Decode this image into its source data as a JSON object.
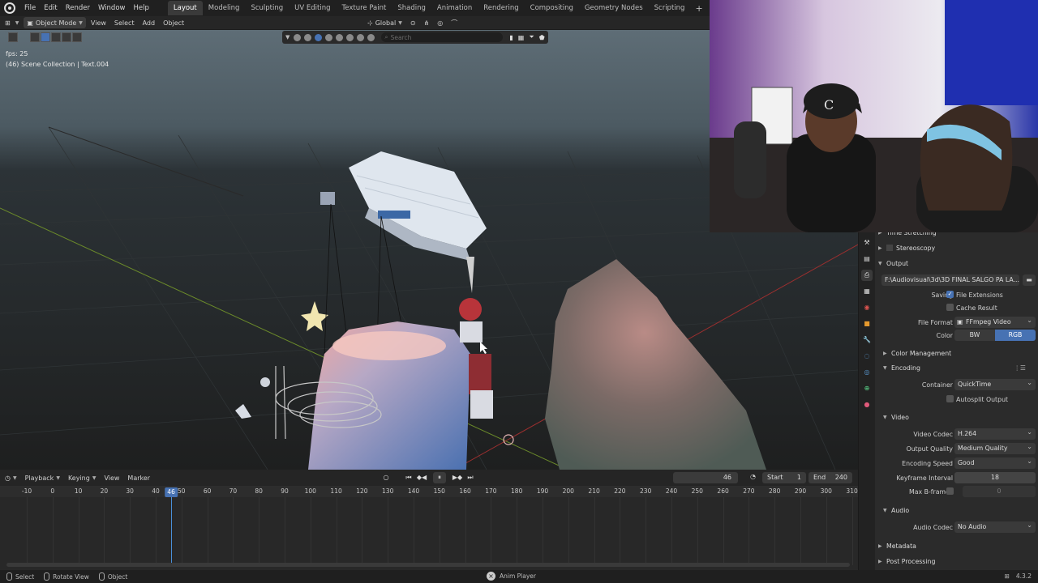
{
  "topbar": {
    "menus": [
      "File",
      "Edit",
      "Render",
      "Window",
      "Help"
    ],
    "workspaces": [
      "Layout",
      "Modeling",
      "Sculpting",
      "UV Editing",
      "Texture Paint",
      "Shading",
      "Animation",
      "Rendering",
      "Compositing",
      "Geometry Nodes",
      "Scripting"
    ],
    "active_workspace": "Layout",
    "add_tab": "+"
  },
  "viewport_header": {
    "mode": "Object Mode",
    "menus": [
      "View",
      "Select",
      "Add",
      "Object"
    ],
    "transform_orientation": "Global",
    "search_placeholder": "Search"
  },
  "viewport": {
    "fps": "fps: 25",
    "collection": "(46) Scene Collection | Text.004"
  },
  "timeline": {
    "menus": [
      "Playback",
      "Keying",
      "View",
      "Marker"
    ],
    "current_frame": "46",
    "start_label": "Start",
    "start_value": "1",
    "end_label": "End",
    "end_value": "240",
    "ruler": [
      "-10",
      "0",
      "10",
      "20",
      "30",
      "40",
      "50",
      "60",
      "70",
      "80",
      "90",
      "100",
      "110",
      "120",
      "130",
      "140",
      "150",
      "160",
      "170",
      "180",
      "190",
      "200",
      "210",
      "220",
      "230",
      "240",
      "250",
      "260",
      "270",
      "280",
      "290",
      "300",
      "310"
    ],
    "playhead_label": "46"
  },
  "statusbar": {
    "select": "Select",
    "rotate": "Rotate View",
    "object": "Object",
    "anim_player": "Anim Player",
    "version": "4.3.2"
  },
  "properties": {
    "time_stretching": "Time Stretching",
    "stereoscopy": "Stereoscopy",
    "output": "Output",
    "output_path": "F:\\Audiovisual\\3d\\3D FINAL SALGO PA LA...",
    "saving_label": "Saving",
    "file_extensions": "File Extensions",
    "cache_result": "Cache Result",
    "file_format_label": "File Format",
    "file_format": "FFmpeg Video",
    "color_label": "Color",
    "color_bw": "BW",
    "color_rgb": "RGB",
    "color_management": "Color Management",
    "encoding": "Encoding",
    "container_label": "Container",
    "container": "QuickTime",
    "autosplit": "Autosplit Output",
    "video": "Video",
    "video_codec_label": "Video Codec",
    "video_codec": "H.264",
    "output_quality_label": "Output Quality",
    "output_quality": "Medium Quality",
    "encoding_speed_label": "Encoding Speed",
    "encoding_speed": "Good",
    "keyframe_interval_label": "Keyframe Interval",
    "keyframe_interval": "18",
    "max_bframes_label": "Max B-frames",
    "max_bframes": "0",
    "audio": "Audio",
    "audio_codec_label": "Audio Codec",
    "audio_codec": "No Audio",
    "metadata": "Metadata",
    "post_processing": "Post Processing"
  },
  "colors": {
    "accent": "#4772b3",
    "panel": "#2b2b2b",
    "header": "#202020"
  }
}
